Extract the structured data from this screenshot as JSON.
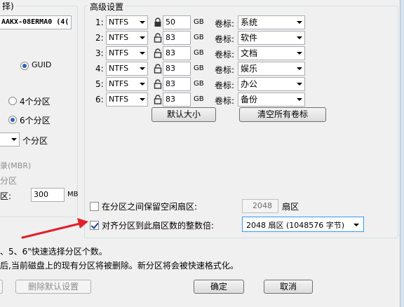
{
  "left_panel": {
    "title_fragment": "择)",
    "disk_name": "AAKX-08ERMA0 (4(",
    "guid_label": "GUID",
    "four_parts_label": "4个分区",
    "six_parts_label": "6个分区",
    "custom_parts_label": "个分区",
    "mbr_fragment": "录(MBR)",
    "fen_qu_fragment": "分区",
    "qu_fragment": "区:",
    "mbr_value": "300",
    "mb_unit": "MB"
  },
  "advanced": {
    "title": "高级设置",
    "size_unit": "GB",
    "label_prefix": "卷标:",
    "rows": [
      {
        "index": "1:",
        "fs": "NTFS",
        "size": "50",
        "label": "系统"
      },
      {
        "index": "2:",
        "fs": "NTFS",
        "size": "83",
        "label": "软件"
      },
      {
        "index": "3:",
        "fs": "NTFS",
        "size": "83",
        "label": "文档"
      },
      {
        "index": "4:",
        "fs": "NTFS",
        "size": "83",
        "label": "娱乐"
      },
      {
        "index": "5:",
        "fs": "NTFS",
        "size": "83",
        "label": "办公"
      },
      {
        "index": "6:",
        "fs": "NTFS",
        "size": "83",
        "label": "备份"
      }
    ],
    "default_size_button": "默认大小",
    "clear_labels_button": "清空所有卷标",
    "reserve_label": "在分区之间保留空闲扇区:",
    "reserve_value": "2048",
    "reserve_unit": "扇区",
    "align_label": "对齐分区到此扇区数的整数倍:",
    "align_value": "2048 扇区 (1048576 字节)"
  },
  "hints": {
    "line1": "、5、6\"快速选择分区个数。",
    "line2": "后,当前磁盘上的现有分区将被删除。新分区将会被快速格式化。"
  },
  "footer": {
    "delete_default_button": "删除默认设置",
    "ok_button": "确定",
    "cancel_button": "取消"
  },
  "colors": {
    "arrow": "#e0202a",
    "radio_dot": "#2c62b7",
    "focus_border": "#3399ff"
  }
}
